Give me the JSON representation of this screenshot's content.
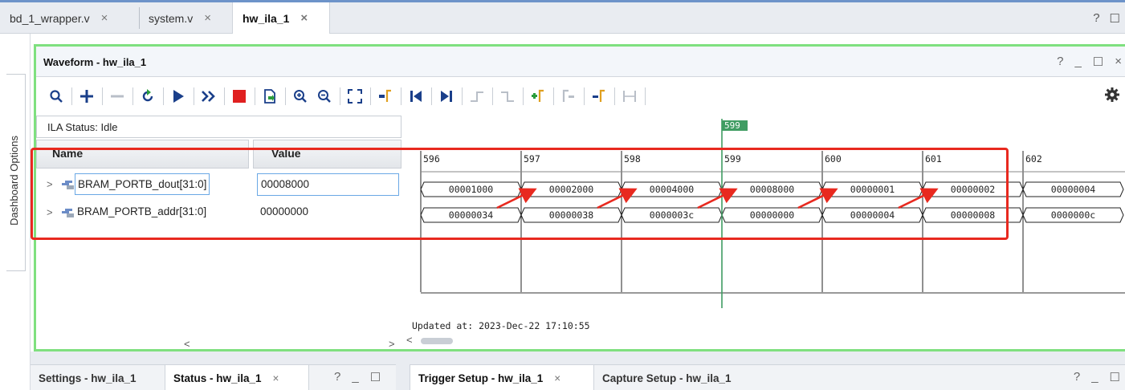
{
  "top_tabs": [
    {
      "label": "bd_1_wrapper.v",
      "close": "×"
    },
    {
      "label": "system.v",
      "close": "×"
    },
    {
      "label": "hw_ila_1",
      "close": "×"
    }
  ],
  "top_controls": {
    "help": "?",
    "restore": "☐"
  },
  "side_tab": {
    "label": "Dashboard Options"
  },
  "waveform": {
    "title": "Waveform - hw_ila_1",
    "controls": {
      "help": "?",
      "minimize": "_",
      "restore": "☐",
      "close": "×"
    },
    "ila_status": "ILA Status: Idle",
    "columns": {
      "name": "Name",
      "value": "Value"
    },
    "signals": [
      {
        "name": "BRAM_PORTB_dout[31:0]",
        "value": "00008000"
      },
      {
        "name": "BRAM_PORTB_addr[31:0]",
        "value": "00000000"
      }
    ],
    "cursor_label": "599",
    "ruler_labels": [
      "596",
      "597",
      "598",
      "599",
      "600",
      "601",
      "602"
    ],
    "dout_values": [
      "00001000",
      "00002000",
      "00004000",
      "00008000",
      "00000001",
      "00000002",
      "00000004"
    ],
    "addr_values": [
      "00000034",
      "00000038",
      "0000003c",
      "00000000",
      "00000004",
      "00000008",
      "0000000c"
    ],
    "updated_at": "Updated at: 2023-Dec-22 17:10:55",
    "scroll_left": "<",
    "scroll_right": ">"
  },
  "toolbar_icons": [
    "search-icon",
    "add-icon",
    "remove-icon",
    "refresh-icon",
    "run-icon",
    "run-immediate-icon",
    "stop-icon",
    "export-icon",
    "zoom-in-icon",
    "zoom-out-icon",
    "zoom-fit-icon",
    "goto-cursor-icon",
    "goto-start-icon",
    "goto-end-icon",
    "prev-transition-icon",
    "next-transition-icon",
    "add-marker-icon",
    "prev-marker-icon",
    "next-marker-icon",
    "swap-cursors-icon",
    "settings-icon"
  ],
  "bottom_left_tabs": [
    {
      "label": "Settings - hw_ila_1"
    },
    {
      "label": "Status - hw_ila_1",
      "close": "×"
    }
  ],
  "bottom_left_controls": {
    "help": "?",
    "minimize": "_",
    "restore": "☐"
  },
  "bottom_right_tabs": [
    {
      "label": "Trigger Setup - hw_ila_1",
      "close": "×"
    },
    {
      "label": "Capture Setup - hw_ila_1"
    }
  ],
  "bottom_right_controls": {
    "help": "?",
    "minimize": "_",
    "restore": "☐"
  },
  "colors": {
    "panel_border": "#7fe07f",
    "highlight": "#e8291f",
    "cursor": "#3f9c62",
    "accent": "#6d93c9"
  }
}
